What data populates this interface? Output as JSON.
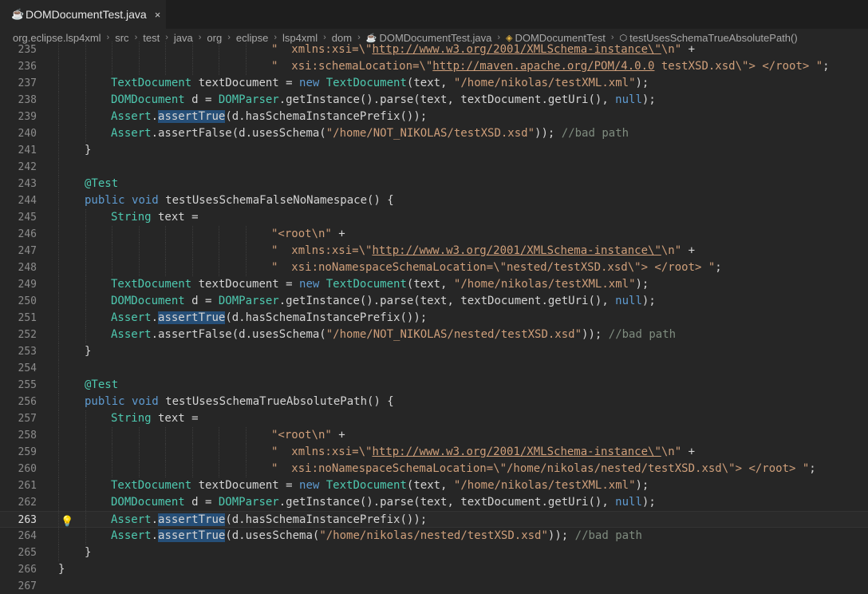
{
  "tab": {
    "title": "DOMDocumentTest.java",
    "close_glyph": "×",
    "icon": "java-file-icon"
  },
  "breadcrumbs": [
    {
      "label": "org.eclipse.lsp4xml",
      "icon": ""
    },
    {
      "label": "src",
      "icon": ""
    },
    {
      "label": "test",
      "icon": ""
    },
    {
      "label": "java",
      "icon": ""
    },
    {
      "label": "org",
      "icon": ""
    },
    {
      "label": "eclipse",
      "icon": ""
    },
    {
      "label": "lsp4xml",
      "icon": ""
    },
    {
      "label": "dom",
      "icon": ""
    },
    {
      "label": "DOMDocumentTest.java",
      "icon": "java-file-icon"
    },
    {
      "label": "DOMDocumentTest",
      "icon": "class-icon"
    },
    {
      "label": "testUsesSchemaTrueAbsolutePath()",
      "icon": "method-icon"
    }
  ],
  "editor": {
    "current_line": 263,
    "lines": [
      {
        "n": "235",
        "t": [
          [
            "s",
            "\"  xmlns:xsi=\\\""
          ],
          [
            "u",
            "http://www.w3.org/2001/XMLSchema-instance\\\""
          ],
          [
            "s",
            "\\n\""
          ],
          [
            "p",
            " +"
          ]
        ],
        "ind": 8
      },
      {
        "n": "236",
        "t": [
          [
            "s",
            "\"  xsi:schemaLocation=\\\""
          ],
          [
            "u",
            "http://maven.apache.org/POM/4.0.0"
          ],
          [
            "s",
            " testXSD.xsd\\\"> </root> \""
          ],
          [
            "p",
            ";"
          ]
        ],
        "ind": 8
      },
      {
        "n": "237",
        "t": [
          [
            "ty",
            "TextDocument"
          ],
          [
            "p",
            " textDocument = "
          ],
          [
            "kw",
            "new"
          ],
          [
            "p",
            " "
          ],
          [
            "ty",
            "TextDocument"
          ],
          [
            "p",
            "(text, "
          ],
          [
            "s",
            "\"/home/nikolas/testXML.xml\""
          ],
          [
            "p",
            ");"
          ]
        ],
        "ind": 1
      },
      {
        "n": "238",
        "t": [
          [
            "ty",
            "DOMDocument"
          ],
          [
            "p",
            " d = "
          ],
          [
            "ty",
            "DOMParser"
          ],
          [
            "p",
            ".getInstance().parse(text, textDocument.getUri(), "
          ],
          [
            "kw",
            "null"
          ],
          [
            "p",
            ");"
          ]
        ],
        "ind": 1
      },
      {
        "n": "239",
        "t": [
          [
            "ty",
            "Assert"
          ],
          [
            "p",
            "."
          ],
          [
            "hl",
            "assertTrue"
          ],
          [
            "p",
            "(d.hasSchemaInstancePrefix());"
          ]
        ],
        "ind": 1
      },
      {
        "n": "240",
        "t": [
          [
            "ty",
            "Assert"
          ],
          [
            "p",
            ".assertFalse(d.usesSchema("
          ],
          [
            "s",
            "\"/home/NOT_NIKOLAS/testXSD.xsd\""
          ],
          [
            "p",
            "));"
          ],
          [
            "p",
            " "
          ],
          [
            "cm",
            "//bad path"
          ]
        ],
        "ind": 1
      },
      {
        "n": "241",
        "t": [
          [
            "p",
            "}"
          ]
        ],
        "ind": 0
      },
      {
        "n": "242",
        "t": [],
        "ind": 0
      },
      {
        "n": "243",
        "t": [
          [
            "an",
            "@Test"
          ]
        ],
        "ind": 0
      },
      {
        "n": "244",
        "t": [
          [
            "kw",
            "public"
          ],
          [
            "p",
            " "
          ],
          [
            "kw",
            "void"
          ],
          [
            "p",
            " testUsesSchemaFalseNoNamespace() {"
          ]
        ],
        "ind": 0
      },
      {
        "n": "245",
        "t": [
          [
            "ty",
            "String"
          ],
          [
            "p",
            " text ="
          ]
        ],
        "ind": 1
      },
      {
        "n": "246",
        "t": [
          [
            "s",
            "\"<root\\n\""
          ],
          [
            "p",
            " +"
          ]
        ],
        "ind": 7
      },
      {
        "n": "247",
        "t": [
          [
            "s",
            "\"  xmlns:xsi=\\\""
          ],
          [
            "u",
            "http://www.w3.org/2001/XMLSchema-instance\\\""
          ],
          [
            "s",
            "\\n\""
          ],
          [
            "p",
            " +"
          ]
        ],
        "ind": 7
      },
      {
        "n": "248",
        "t": [
          [
            "s",
            "\"  xsi:noNamespaceSchemaLocation=\\\"nested/testXSD.xsd\\\"> </root> \""
          ],
          [
            "p",
            ";"
          ]
        ],
        "ind": 7
      },
      {
        "n": "249",
        "t": [
          [
            "ty",
            "TextDocument"
          ],
          [
            "p",
            " textDocument = "
          ],
          [
            "kw",
            "new"
          ],
          [
            "p",
            " "
          ],
          [
            "ty",
            "TextDocument"
          ],
          [
            "p",
            "(text, "
          ],
          [
            "s",
            "\"/home/nikolas/testXML.xml\""
          ],
          [
            "p",
            ");"
          ]
        ],
        "ind": 1
      },
      {
        "n": "250",
        "t": [
          [
            "ty",
            "DOMDocument"
          ],
          [
            "p",
            " d = "
          ],
          [
            "ty",
            "DOMParser"
          ],
          [
            "p",
            ".getInstance().parse(text, textDocument.getUri(), "
          ],
          [
            "kw",
            "null"
          ],
          [
            "p",
            ");"
          ]
        ],
        "ind": 1
      },
      {
        "n": "251",
        "t": [
          [
            "ty",
            "Assert"
          ],
          [
            "p",
            "."
          ],
          [
            "hl",
            "assertTrue"
          ],
          [
            "p",
            "(d.hasSchemaInstancePrefix());"
          ]
        ],
        "ind": 1
      },
      {
        "n": "252",
        "t": [
          [
            "ty",
            "Assert"
          ],
          [
            "p",
            ".assertFalse(d.usesSchema("
          ],
          [
            "s",
            "\"/home/NOT_NIKOLAS/nested/testXSD.xsd\""
          ],
          [
            "p",
            "));"
          ],
          [
            "p",
            " "
          ],
          [
            "cm",
            "//bad path"
          ]
        ],
        "ind": 1
      },
      {
        "n": "253",
        "t": [
          [
            "p",
            "}"
          ]
        ],
        "ind": 0
      },
      {
        "n": "254",
        "t": [],
        "ind": 0
      },
      {
        "n": "255",
        "t": [
          [
            "an",
            "@Test"
          ]
        ],
        "ind": 0
      },
      {
        "n": "256",
        "t": [
          [
            "kw",
            "public"
          ],
          [
            "p",
            " "
          ],
          [
            "kw",
            "void"
          ],
          [
            "p",
            " testUsesSchemaTrueAbsolutePath() {"
          ]
        ],
        "ind": 0
      },
      {
        "n": "257",
        "t": [
          [
            "ty",
            "String"
          ],
          [
            "p",
            " text ="
          ]
        ],
        "ind": 1
      },
      {
        "n": "258",
        "t": [
          [
            "s",
            "\"<root\\n\""
          ],
          [
            "p",
            " +"
          ]
        ],
        "ind": 7
      },
      {
        "n": "259",
        "t": [
          [
            "s",
            "\"  xmlns:xsi=\\\""
          ],
          [
            "u",
            "http://www.w3.org/2001/XMLSchema-instance\\\""
          ],
          [
            "s",
            "\\n\""
          ],
          [
            "p",
            " +"
          ]
        ],
        "ind": 7
      },
      {
        "n": "260",
        "t": [
          [
            "s",
            "\"  xsi:noNamespaceSchemaLocation=\\\"/home/nikolas/nested/testXSD.xsd\\\"> </root> \""
          ],
          [
            "p",
            ";"
          ]
        ],
        "ind": 7
      },
      {
        "n": "261",
        "t": [
          [
            "ty",
            "TextDocument"
          ],
          [
            "p",
            " textDocument = "
          ],
          [
            "kw",
            "new"
          ],
          [
            "p",
            " "
          ],
          [
            "ty",
            "TextDocument"
          ],
          [
            "p",
            "(text, "
          ],
          [
            "s",
            "\"/home/nikolas/testXML.xml\""
          ],
          [
            "p",
            ");"
          ]
        ],
        "ind": 1
      },
      {
        "n": "262",
        "t": [
          [
            "ty",
            "DOMDocument"
          ],
          [
            "p",
            " d = "
          ],
          [
            "ty",
            "DOMParser"
          ],
          [
            "p",
            ".getInstance().parse(text, textDocument.getUri(), "
          ],
          [
            "kw",
            "null"
          ],
          [
            "p",
            ");"
          ]
        ],
        "ind": 1
      },
      {
        "n": "263",
        "t": [
          [
            "ty",
            "Assert"
          ],
          [
            "p",
            "."
          ],
          [
            "hl",
            "assertTrue"
          ],
          [
            "p",
            "(d.hasSchemaInstancePrefix());"
          ]
        ],
        "ind": 1
      },
      {
        "n": "264",
        "t": [
          [
            "ty",
            "Assert"
          ],
          [
            "p",
            "."
          ],
          [
            "hl",
            "assertTrue"
          ],
          [
            "p",
            "(d.usesSchema("
          ],
          [
            "s",
            "\"/home/nikolas/nested/testXSD.xsd\""
          ],
          [
            "p",
            "));"
          ],
          [
            "p",
            " "
          ],
          [
            "cm",
            "//bad path"
          ]
        ],
        "ind": 1
      },
      {
        "n": "265",
        "t": [
          [
            "p",
            "}"
          ]
        ],
        "ind": 0
      },
      {
        "n": "266",
        "t": [
          [
            "p",
            "}"
          ]
        ],
        "ind": -1
      },
      {
        "n": "267",
        "t": [],
        "ind": -1
      }
    ]
  },
  "colors": {
    "background": "#262626",
    "keyword": "#5f9bd1",
    "type": "#4ec9b0",
    "string": "#cf9f7a",
    "comment": "#7f8c7f",
    "highlight": "#264f78"
  }
}
